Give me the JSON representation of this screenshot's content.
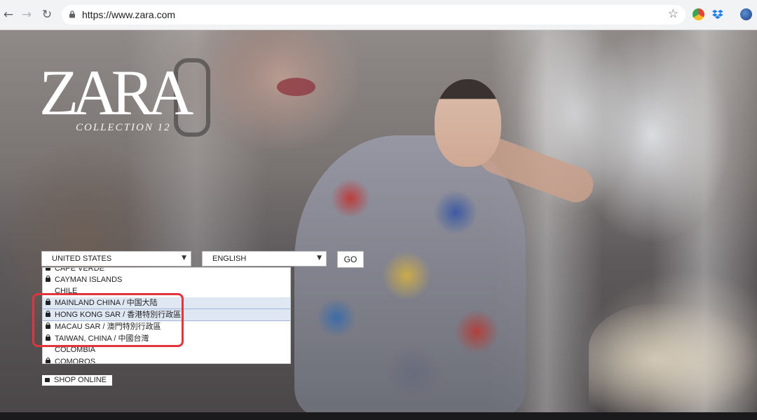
{
  "browser": {
    "url": "https://www.zara.com",
    "back_icon": "arrow-left-icon",
    "forward_icon": "arrow-right-icon",
    "reload_icon": "reload-icon",
    "bookmark_icon": "star-icon"
  },
  "brand": {
    "logo": "ZARA",
    "collection": "COLLECTION 12"
  },
  "selectors": {
    "country": "UNITED STATES",
    "language": "ENGLISH",
    "go_label": "GO"
  },
  "countries": [
    "CAPE VERDE",
    "CAYMAN ISLANDS",
    "CHILE",
    "MAINLAND CHINA / 中国大陆",
    "HONG KONG SAR / 香港特別行政區",
    "MACAU SAR / 澳門特別行政區",
    "TAIWAN, CHINA / 中國台灣",
    "COLOMBIA",
    "COMOROS"
  ],
  "shop_online": "SHOP ONLINE",
  "colors": {
    "highlight": "#e3343d",
    "selected_row": "#dfe7f3"
  }
}
